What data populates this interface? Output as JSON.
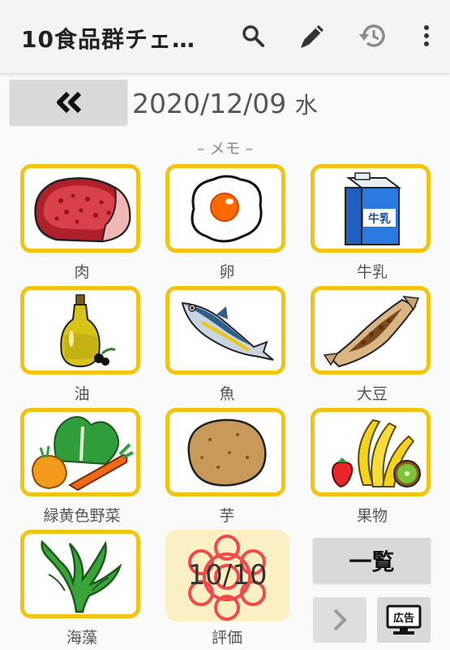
{
  "app": {
    "title": "10食品群チェ…"
  },
  "toolbar": {
    "search_icon": "search-icon",
    "edit_icon": "pencil-icon",
    "history_icon": "history-icon",
    "menu_icon": "more-vert-icon"
  },
  "date_nav": {
    "back_label": "«",
    "date": "2020/12/09",
    "weekday": "水"
  },
  "memo": {
    "label": "– メモ –"
  },
  "foods": [
    {
      "label": "肉",
      "icon": "meat-icon"
    },
    {
      "label": "卵",
      "icon": "egg-icon"
    },
    {
      "label": "牛乳",
      "icon": "milk-icon",
      "carton_text": "牛乳"
    },
    {
      "label": "油",
      "icon": "oil-icon"
    },
    {
      "label": "魚",
      "icon": "fish-icon"
    },
    {
      "label": "大豆",
      "icon": "natto-icon"
    },
    {
      "label": "緑黄色野菜",
      "icon": "vegetables-icon"
    },
    {
      "label": "芋",
      "icon": "potato-icon"
    },
    {
      "label": "果物",
      "icon": "fruits-icon"
    },
    {
      "label": "海藻",
      "icon": "seaweed-icon"
    }
  ],
  "evaluation": {
    "label": "評価",
    "score": "10/10",
    "icon": "flower-stamp-icon"
  },
  "buttons": {
    "list_label": "一覧",
    "next_icon": "chevron-right-icon",
    "ad_label": "広告"
  },
  "colors": {
    "tile_border": "#f1c40f",
    "eval_bg": "#fbefc4",
    "button_bg": "#d9d9d9"
  }
}
